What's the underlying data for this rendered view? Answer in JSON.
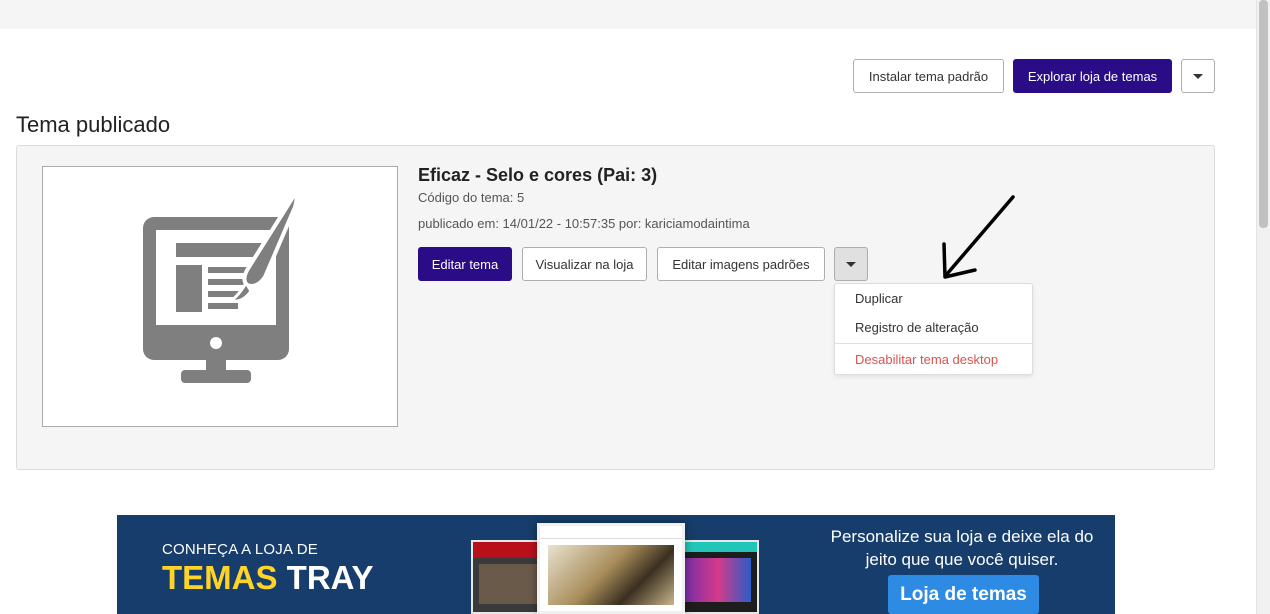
{
  "header": {
    "install_default_label": "Instalar tema padrão",
    "explore_store_label": "Explorar loja de temas"
  },
  "section": {
    "title": "Tema publicado"
  },
  "theme": {
    "name": "Eficaz - Selo e cores (Pai: 3)",
    "code_line": "Código do tema: 5",
    "published_line": "publicado em: 14/01/22 - 10:57:35 por: kariciamodaintima"
  },
  "actions": {
    "edit_label": "Editar tema",
    "view_label": "Visualizar na loja",
    "edit_images_label": "Editar imagens padrões"
  },
  "dropdown": {
    "items": [
      "Duplicar",
      "Registro de alteração"
    ],
    "danger_item": "Desabilitar tema desktop"
  },
  "banner": {
    "kicker": "CONHEÇA A LOJA DE",
    "title_part1": "TEMAS",
    "title_part2": "TRAY",
    "tagline": "Personalize sua loja e deixe ela do jeito que que você quiser.",
    "cta_label": "Loja de temas"
  },
  "colors": {
    "primary": "#2a0c86",
    "danger": "#d9534f",
    "banner_bg": "#163d6b",
    "banner_accent": "#ffd426",
    "banner_cta": "#2d8be3"
  }
}
